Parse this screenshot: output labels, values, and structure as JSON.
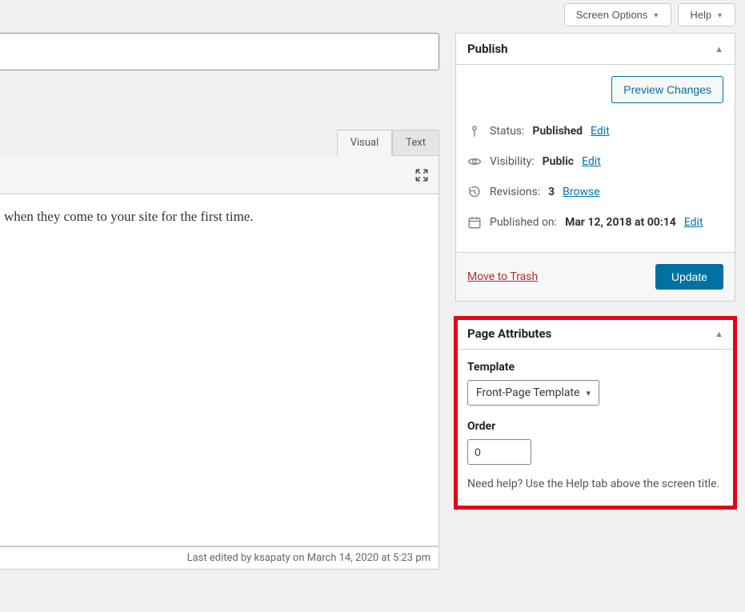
{
  "topbar": {
    "screen_options": "Screen Options",
    "help": "Help"
  },
  "editor": {
    "tab_visual": "Visual",
    "tab_text": "Text",
    "content_visible": "when they come to your site for the first time.",
    "status_text": "Last edited by ksapaty on March 14, 2020 at 5:23 pm"
  },
  "publish": {
    "title": "Publish",
    "preview_btn": "Preview Changes",
    "status_label": "Status:",
    "status_value": "Published",
    "edit": "Edit",
    "visibility_label": "Visibility:",
    "visibility_value": "Public",
    "revisions_label": "Revisions:",
    "revisions_value": "3",
    "browse": "Browse",
    "published_label": "Published on:",
    "published_value": "Mar 12, 2018 at 00:14",
    "trash": "Move to Trash",
    "update": "Update"
  },
  "page_attributes": {
    "title": "Page Attributes",
    "template_label": "Template",
    "template_value": "Front-Page Template",
    "order_label": "Order",
    "order_value": "0",
    "help_note": "Need help? Use the Help tab above the screen title."
  }
}
